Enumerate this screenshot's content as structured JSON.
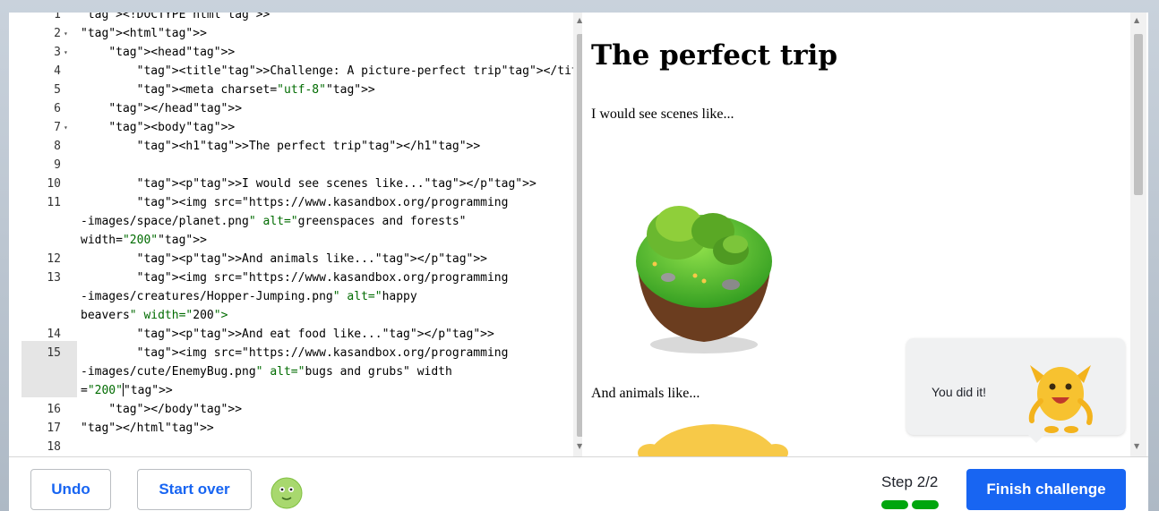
{
  "editor": {
    "lines": [
      {
        "num": "1",
        "fold": "",
        "text": "<!DOCTYPE html>"
      },
      {
        "num": "2",
        "fold": "▾",
        "text": "<html>"
      },
      {
        "num": "3",
        "fold": "▾",
        "text": "    <head>"
      },
      {
        "num": "4",
        "fold": "",
        "text": "        <title>Challenge: A picture-perfect trip</title>"
      },
      {
        "num": "5",
        "fold": "",
        "text": "        <meta charset=\"utf-8\">"
      },
      {
        "num": "6",
        "fold": "",
        "text": "    </head>"
      },
      {
        "num": "7",
        "fold": "▾",
        "text": "    <body>"
      },
      {
        "num": "8",
        "fold": "",
        "text": "        <h1>The perfect trip</h1>"
      },
      {
        "num": "9",
        "fold": "",
        "text": ""
      },
      {
        "num": "10",
        "fold": "",
        "text": "        <p>I would see scenes like...</p>"
      },
      {
        "num": "11",
        "fold": "",
        "text": "        <img src=\"https://www.kasandbox.org/programming"
      },
      {
        "num": "",
        "fold": "",
        "text": "-images/space/planet.png\" alt=\"greenspaces and forests\""
      },
      {
        "num": "",
        "fold": "",
        "text": "width=\"200\">"
      },
      {
        "num": "12",
        "fold": "",
        "text": "        <p>And animals like...</p>"
      },
      {
        "num": "13",
        "fold": "",
        "text": "        <img src=\"https://www.kasandbox.org/programming"
      },
      {
        "num": "",
        "fold": "",
        "text": "-images/creatures/Hopper-Jumping.png\" alt=\"happy"
      },
      {
        "num": "",
        "fold": "",
        "text": "beavers\" width=\"200\">"
      },
      {
        "num": "14",
        "fold": "",
        "text": "        <p>And eat food like...</p>"
      },
      {
        "num": "15",
        "fold": "",
        "text": "        <img src=\"https://www.kasandbox.org/programming"
      },
      {
        "num": "",
        "fold": "",
        "text": "-images/cute/EnemyBug.png\" alt=\"bugs and grubs\" width"
      },
      {
        "num": "",
        "fold": "",
        "text": "=\"200\">"
      },
      {
        "num": "16",
        "fold": "",
        "text": "    </body>"
      },
      {
        "num": "17",
        "fold": "",
        "text": "</html>"
      },
      {
        "num": "18",
        "fold": "",
        "text": ""
      }
    ],
    "active_line": "15"
  },
  "preview": {
    "heading": "The perfect trip",
    "paragraphs": [
      "I would see scenes like...",
      "And animals like..."
    ],
    "toast_text": "You did it!"
  },
  "footer": {
    "undo_label": "Undo",
    "start_over_label": "Start over",
    "step_label": "Step 2/2",
    "finish_label": "Finish challenge"
  },
  "colors": {
    "accent": "#1865f2",
    "progress": "#00a60e",
    "tag": "#0000a0",
    "string": "#006b00"
  }
}
